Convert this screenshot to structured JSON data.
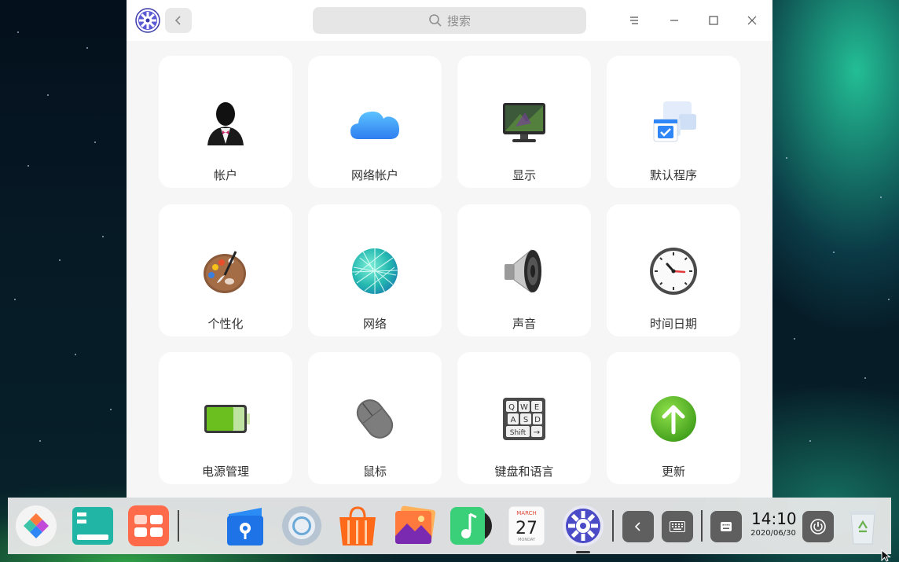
{
  "window": {
    "search_placeholder": "搜索",
    "app_icon": "settings-gear-icon",
    "controls": [
      "menu-icon",
      "minimize-icon",
      "maximize-icon",
      "close-icon"
    ]
  },
  "modules": [
    {
      "label": "帐户",
      "icon": "account-icon"
    },
    {
      "label": "网络帐户",
      "icon": "cloud-icon"
    },
    {
      "label": "显示",
      "icon": "monitor-icon"
    },
    {
      "label": "默认程序",
      "icon": "default-apps-icon"
    },
    {
      "label": "个性化",
      "icon": "palette-icon"
    },
    {
      "label": "网络",
      "icon": "network-globe-icon"
    },
    {
      "label": "声音",
      "icon": "speaker-icon"
    },
    {
      "label": "时间日期",
      "icon": "clock-icon"
    },
    {
      "label": "电源管理",
      "icon": "battery-icon"
    },
    {
      "label": "鼠标",
      "icon": "mouse-icon"
    },
    {
      "label": "键盘和语言",
      "icon": "keyboard-icon"
    },
    {
      "label": "更新",
      "icon": "update-arrow-icon"
    }
  ],
  "calendar_icon": {
    "month": "MARCH",
    "day": "27",
    "weekday": "MONDAY"
  },
  "keyboard_keys": {
    "row1": "QWE",
    "row2": "ASD",
    "shift": "Shift"
  },
  "dock": {
    "time": "14:10",
    "date": "2020/06/30"
  },
  "colors": {
    "window_bg": "#f6f6f6",
    "card_bg": "#ffffff",
    "dock_bg": "#ececec",
    "accent_blue": "#2f86f6"
  }
}
